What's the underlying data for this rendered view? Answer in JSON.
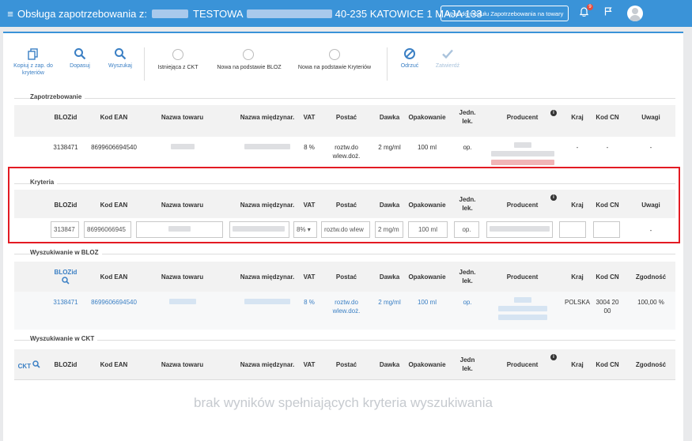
{
  "header": {
    "title_prefix": "Obsługa zapotrzebowania z:",
    "title_mid": "TESTOWA",
    "title_suffix": "40-235 KATOWICE 1 MAJA 133",
    "back_button": "Wróć do modułu Zapotrzebowania na towary",
    "notifications_count": "9"
  },
  "toolbar": {
    "copy": "Kopiuj z zap. do kryteriów",
    "match": "Dopasuj",
    "search": "Wyszukaj",
    "radio1": "Istniejąca z CKT",
    "radio2": "Nowa na podstawie BLOZ",
    "radio3": "Nowa na podstawie Kryteriów",
    "reject": "Odrzuć",
    "approve": "Zatwierdź"
  },
  "sections": {
    "demand": "Zapotrzebowanie",
    "criteria": "Kryteria",
    "bloz": "Wyszukiwanie w BLOZ",
    "ckt": "Wyszukiwanie w CKT"
  },
  "columns": {
    "blozid": "BLOZid",
    "ean": "Kod EAN",
    "name": "Nazwa towaru",
    "intl": "Nazwa międzynar.",
    "vat": "VAT",
    "form": "Postać",
    "dose": "Dawka",
    "pack": "Opakowanie",
    "unit": "Jedn. lek.",
    "unit_ckt": "Jedn lek.",
    "producer": "Producent",
    "country": "Kraj",
    "cn": "Kod CN",
    "notes": "Uwagi",
    "match": "Zgodność",
    "ckt": "CKT"
  },
  "demand_row": {
    "blozid": "3138471",
    "ean": "8699606694540",
    "vat": "8 %",
    "form": "roztw.do wlew.doż.",
    "dose": "2 mg/ml",
    "pack": "100 ml",
    "unit": "op.",
    "country": "-",
    "cn": "-",
    "notes": "-"
  },
  "criteria_row": {
    "blozid": "313847",
    "ean": "86996066945",
    "vat": "8%",
    "form": "roztw.do wlew",
    "dose": "2 mg/m",
    "pack": "100 ml",
    "unit": "op.",
    "notes": "-"
  },
  "bloz_row": {
    "blozid": "3138471",
    "ean": "8699606694540",
    "vat": "8 %",
    "form": "roztw.do wlew.doż.",
    "dose": "2 mg/ml",
    "pack": "100 ml",
    "unit": "op.",
    "country": "POLSKA",
    "cn": "3004 20 00",
    "match": "100,00 %"
  },
  "no_results": "brak wyników spełniających kryteria wyszukiwania"
}
